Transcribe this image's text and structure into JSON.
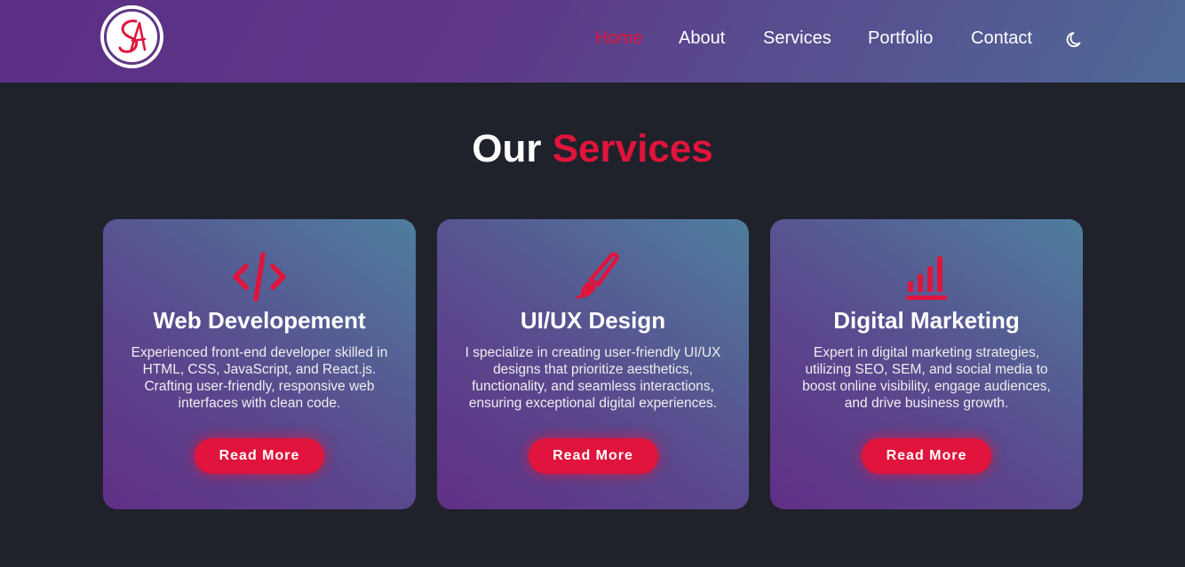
{
  "header": {
    "logo_icon": "signature-logo-icon",
    "nav": [
      {
        "label": "Home",
        "active": true
      },
      {
        "label": "About",
        "active": false
      },
      {
        "label": "Services",
        "active": false
      },
      {
        "label": "Portfolio",
        "active": false
      },
      {
        "label": "Contact",
        "active": false
      }
    ],
    "theme_toggle_icon": "moon-icon"
  },
  "services": {
    "title_prefix": "Our",
    "title_accent": "Services",
    "cards": [
      {
        "icon": "code-icon",
        "title": "Web Developement",
        "description": "Experienced front-end developer skilled in HTML, CSS, JavaScript, and React.js. Crafting user-friendly, responsive web interfaces with clean code.",
        "button": "Read More"
      },
      {
        "icon": "paintbrush-icon",
        "title": "UI/UX Design",
        "description": "I specialize in creating user-friendly UI/UX designs that prioritize aesthetics, functionality, and seamless interactions, ensuring exceptional digital experiences.",
        "button": "Read More"
      },
      {
        "icon": "bar-chart-icon",
        "title": "Digital Marketing",
        "description": "Expert in digital marketing strategies, utilizing SEO, SEM, and social media to boost online visibility, engage audiences, and drive business growth.",
        "button": "Read More"
      }
    ]
  },
  "colors": {
    "accent": "#e0143c",
    "background": "#1f222b",
    "header_gradient_start": "#5b2f86",
    "header_gradient_end": "#4f6a98"
  }
}
